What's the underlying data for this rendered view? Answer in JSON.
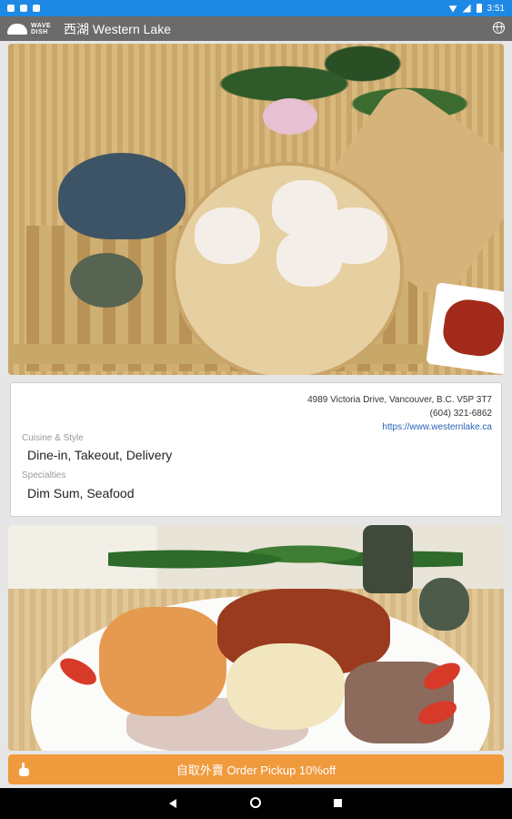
{
  "status_bar": {
    "time": "3:51"
  },
  "app_bar": {
    "logo_text": "WAVE DISH",
    "title": "西湖 Western Lake"
  },
  "restaurant": {
    "address": "4989 Victoria Drive, Vancouver, B.C. V5P 3T7",
    "phone": "(604) 321-6862",
    "website": "https://www.westernlake.ca",
    "cuisine_label": "Cuisine & Style",
    "cuisine_value": "Dine-in, Takeout, Delivery",
    "specialties_label": "Specialties",
    "specialties_value": "Dim Sum, Seafood"
  },
  "order_button": {
    "label": "自取外賣 Order Pickup 10%off",
    "color": "#f09a3e"
  },
  "icons": [
    "globe-icon",
    "hand-pointer-icon",
    "back-icon",
    "home-icon",
    "recents-icon"
  ]
}
